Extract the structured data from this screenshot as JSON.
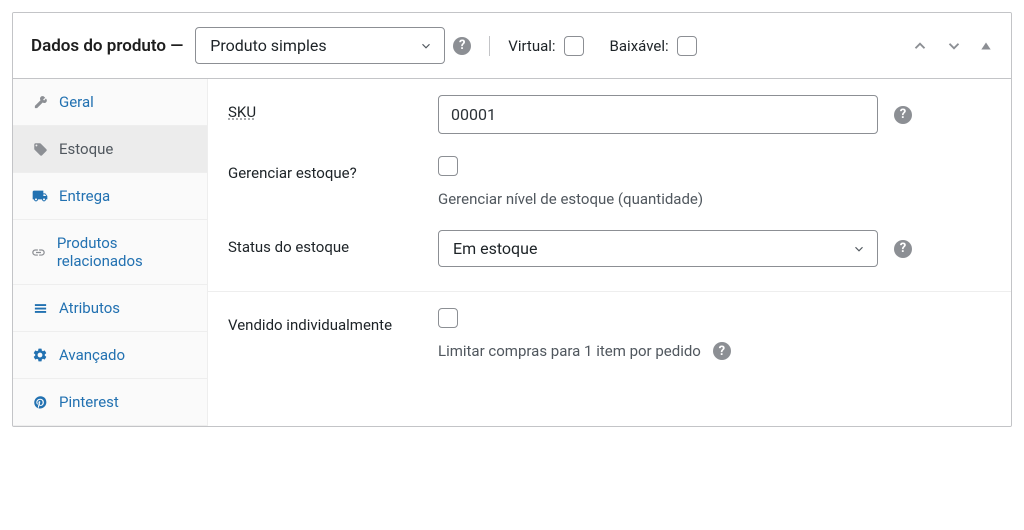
{
  "header": {
    "title_prefix": "Dados do produto —",
    "product_type": "Produto simples",
    "virtual_label": "Virtual:",
    "downloadable_label": "Baixável:"
  },
  "tabs": {
    "general": "Geral",
    "inventory": "Estoque",
    "shipping": "Entrega",
    "linked": "Produtos relacionados",
    "attributes": "Atributos",
    "advanced": "Avançado",
    "pinterest": "Pinterest"
  },
  "fields": {
    "sku_label": "SKU",
    "sku_value": "00001",
    "manage_label": "Gerenciar estoque?",
    "manage_desc": "Gerenciar nível de estoque (quantidade)",
    "status_label": "Status do estoque",
    "status_value": "Em estoque",
    "sold_label": "Vendido individualmente",
    "sold_desc": "Limitar compras para 1 item por pedido"
  }
}
